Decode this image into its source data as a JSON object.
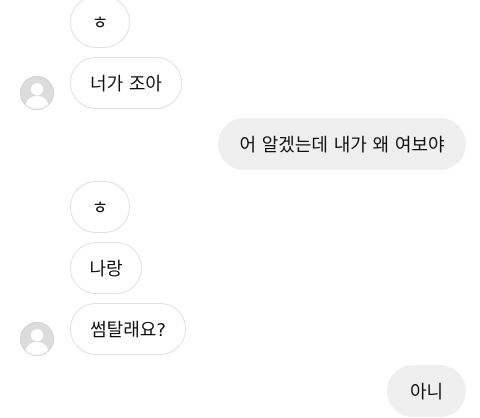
{
  "chat": {
    "messages": [
      {
        "sender": "other",
        "text": "ㅎ"
      },
      {
        "sender": "other",
        "text": "너가 조아"
      },
      {
        "sender": "me",
        "text": "어 알겠는데 내가 왜 여보야"
      },
      {
        "sender": "other",
        "text": "ㅎ"
      },
      {
        "sender": "other",
        "text": "나랑"
      },
      {
        "sender": "other",
        "text": "썸탈래요?"
      },
      {
        "sender": "me",
        "text": "아니"
      }
    ],
    "avatar_icon": "default-user-avatar-icon",
    "colors": {
      "incoming_bubble_border": "#e1e1e1",
      "outgoing_bubble_bg": "#efefef",
      "avatar_bg": "#dcdcdc"
    }
  }
}
